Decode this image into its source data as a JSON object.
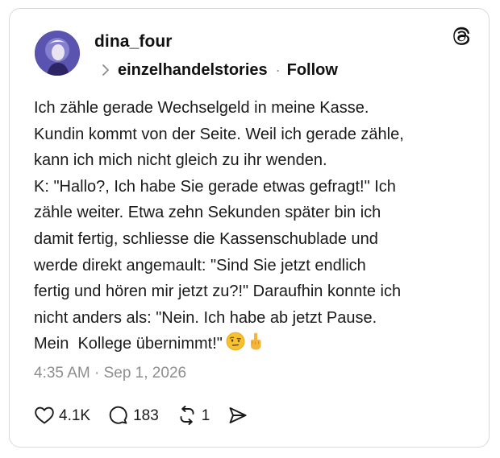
{
  "post": {
    "author": "dina_four",
    "reply_to": "einzelhandelstories",
    "separator": "·",
    "follow_label": "Follow",
    "text": "Ich zähle gerade Wechselgeld in meine Kasse.\nKundin kommt von der Seite. Weil ich gerade zähle,\nkann ich mich nicht gleich zu ihr wenden.\nK: \"Hallo?, Ich habe Sie gerade etwas gefragt!\" Ich\nzähle weiter. Etwa zehn Sekunden später bin ich\ndamit fertig, schliesse die Kassenschublade und\nwerde direkt angemault: \"Sind Sie jetzt endlich\nfertig und hören mir jetzt zu?!\" Daraufhin konnte ich\nnicht anders als: \"Nein. Ich habe ab jetzt Pause.\nMein  Kollege übernimmt!\"",
    "emojis": [
      "face-with-raised-eyebrow-emoji",
      "middle-finger-emoji"
    ],
    "timestamp": "4:35 AM · Sep 1, 2026"
  },
  "stats": {
    "likes": "4.1K",
    "replies": "183",
    "reposts": "1"
  },
  "icons": {
    "brand": "threads-logo-icon",
    "like": "heart-icon",
    "reply": "comment-icon",
    "repost": "repost-icon",
    "share": "send-icon",
    "chevron": "chevron-right-icon"
  },
  "colors": {
    "text": "#1a1a1a",
    "muted": "#8e8e8e",
    "border": "#d9d9d9"
  }
}
